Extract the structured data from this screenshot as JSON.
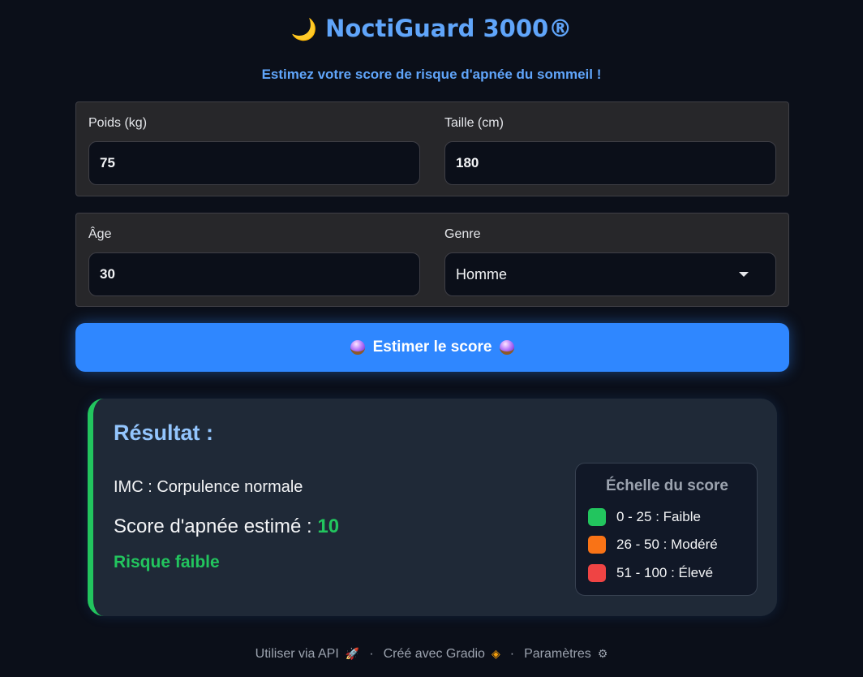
{
  "header": {
    "title": "NoctiGuard 3000®",
    "subtitle": "Estimez votre score de risque d'apnée du sommeil !"
  },
  "form": {
    "weight": {
      "label": "Poids (kg)",
      "value": "75"
    },
    "height": {
      "label": "Taille (cm)",
      "value": "180"
    },
    "age": {
      "label": "Âge",
      "value": "30"
    },
    "gender": {
      "label": "Genre",
      "value": "Homme"
    }
  },
  "action": {
    "label": "Estimer le score"
  },
  "result": {
    "title": "Résultat :",
    "imc": "IMC : Corpulence normale",
    "score_label": "Score d'apnée estimé :",
    "score_value": "10",
    "risk": "Risque faible"
  },
  "scale": {
    "title": "Échelle du score",
    "items": [
      {
        "label": "0 - 25 : Faible",
        "color": "#22c55e"
      },
      {
        "label": "26 - 50 : Modéré",
        "color": "#f97316"
      },
      {
        "label": "51 - 100 : Élevé",
        "color": "#ef4444"
      }
    ]
  },
  "footer": {
    "api": "Utiliser via API",
    "gradio": "Créé avec Gradio",
    "settings": "Paramètres",
    "separator": "·"
  },
  "colors": {
    "accent": "#60a5fa",
    "button": "#2f87ff",
    "success": "#22c55e"
  }
}
